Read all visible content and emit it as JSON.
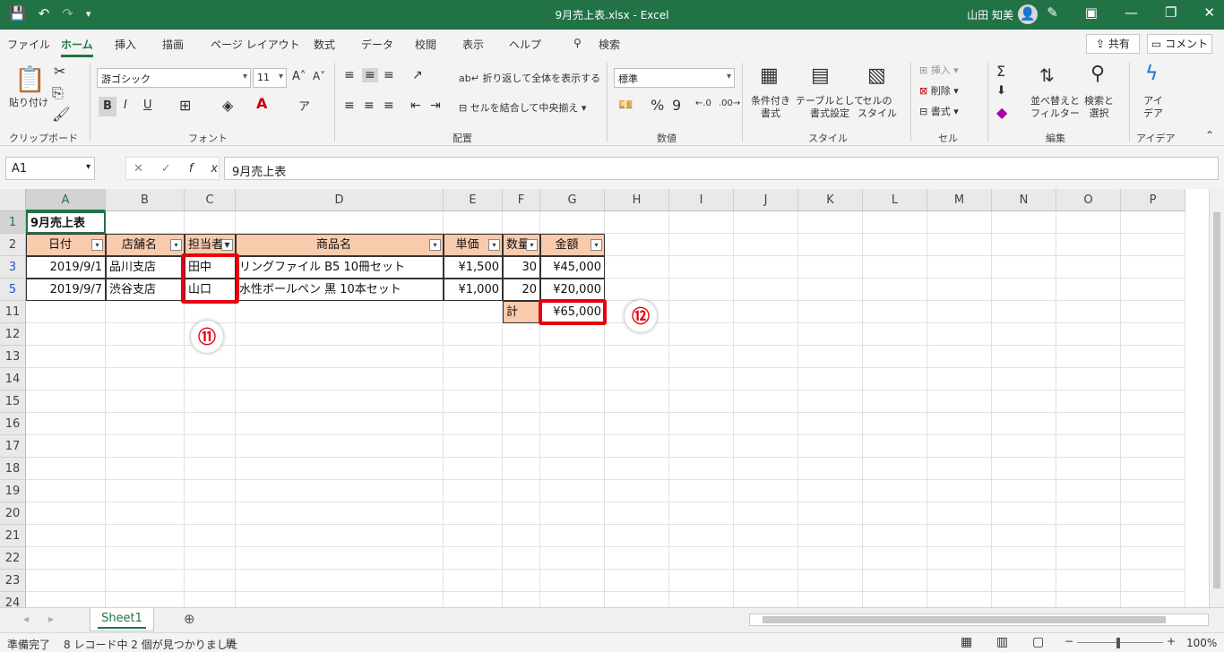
{
  "titlebar": {
    "title": "9月売上表.xlsx  -  Excel",
    "user": "山田 知美",
    "save_icon": "💾",
    "undo_icon": "↶",
    "redo_icon": "↷",
    "customize_icon": "▾"
  },
  "tabs": [
    "ファイル",
    "ホーム",
    "挿入",
    "描画",
    "ページ レイアウト",
    "数式",
    "データ",
    "校閲",
    "表示",
    "ヘルプ",
    "検索"
  ],
  "tab_active": "ホーム",
  "share_label": "共有",
  "comment_label": "コメント",
  "ribbon": {
    "clipboard": {
      "label": "クリップボード",
      "paste": "貼り付け"
    },
    "font": {
      "label": "フォント",
      "name": "游ゴシック",
      "size": "11",
      "bold": "B",
      "italic": "I",
      "underline": "U"
    },
    "alignment": {
      "label": "配置",
      "wrap": "折り返して全体を表示する",
      "merge": "セルを結合して中央揃え"
    },
    "number": {
      "label": "数値",
      "format": "標準"
    },
    "styles": {
      "label": "スタイル",
      "conditional": "条件付き\n書式",
      "table": "テーブルとして\n書式設定",
      "cell_styles": "セルの\nスタイル"
    },
    "cells": {
      "label": "セル",
      "insert": "挿入",
      "delete": "削除",
      "format": "書式"
    },
    "editing": {
      "label": "編集",
      "sort": "並べ替えと\nフィルター",
      "find": "検索と\n選択"
    },
    "ideas": {
      "label": "アイデア",
      "btn": "アイ\nデア"
    }
  },
  "formula_bar": {
    "namebox": "A1",
    "content": "9月売上表",
    "fx": "fx"
  },
  "columns": [
    "A",
    "B",
    "C",
    "D",
    "E",
    "F",
    "G",
    "H",
    "I",
    "J",
    "K",
    "L",
    "M",
    "N",
    "O",
    "P"
  ],
  "rows": [
    "1",
    "2",
    "3",
    "5",
    "11",
    "12",
    "13",
    "14",
    "15",
    "16",
    "17",
    "18",
    "19",
    "20",
    "21",
    "22",
    "23",
    "24"
  ],
  "cells": {
    "title": "9月売上表",
    "headers": [
      "日付",
      "店舗名",
      "担当者",
      "商品名",
      "単価",
      "数量",
      "金額"
    ],
    "row3": [
      "2019/9/1",
      "品川支店",
      "田中",
      "リングファイル B5 10冊セット",
      "¥1,500",
      "30",
      "¥45,000"
    ],
    "row5": [
      "2019/9/7",
      "渋谷支店",
      "山口",
      "水性ボールペン 黒 10本セット",
      "¥1,000",
      "20",
      "¥20,000"
    ],
    "total_label": "計",
    "total_value": "¥65,000"
  },
  "annotations": {
    "badge1": "⑪",
    "badge2": "⑫"
  },
  "sheet_tab": "Sheet1",
  "status": {
    "ready": "準備完了",
    "filter_msg": "8 レコード中 2 個が見つかりました",
    "zoom": "100%"
  },
  "colors": {
    "excel_green": "#217346",
    "header_fill": "#f8cbad",
    "highlight_red": "#e60012"
  }
}
